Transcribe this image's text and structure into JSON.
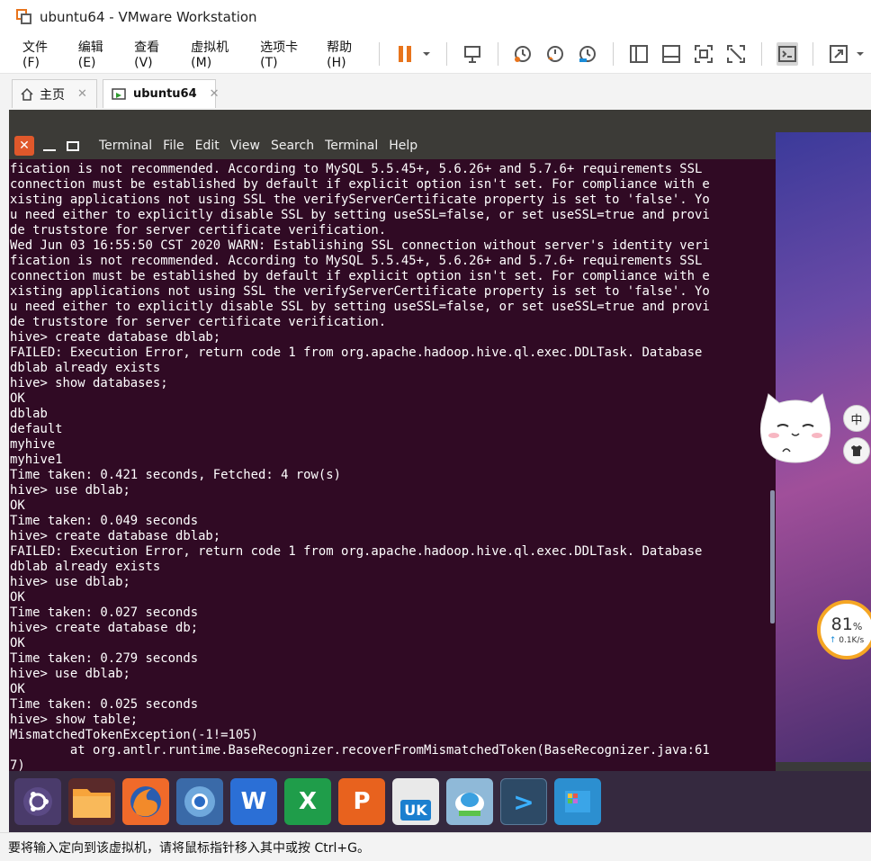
{
  "window": {
    "title": "ubuntu64 - VMware Workstation",
    "icon": "vmware-icon"
  },
  "menu": {
    "items": [
      "文件(F)",
      "编辑(E)",
      "查看(V)",
      "虚拟机(M)",
      "选项卡(T)",
      "帮助(H)"
    ]
  },
  "tabs": [
    {
      "label": "主页",
      "icon": "home-icon"
    },
    {
      "label": "ubuntu64",
      "icon": "vm-icon"
    }
  ],
  "terminal": {
    "menu": [
      "Terminal",
      "File",
      "Edit",
      "View",
      "Search",
      "Terminal",
      "Help"
    ],
    "lines": [
      "fication is not recommended. According to MySQL 5.5.45+, 5.6.26+ and 5.7.6+ requirements SSL",
      "connection must be established by default if explicit option isn't set. For compliance with e",
      "xisting applications not using SSL the verifyServerCertificate property is set to 'false'. Yo",
      "u need either to explicitly disable SSL by setting useSSL=false, or set useSSL=true and provi",
      "de truststore for server certificate verification.",
      "Wed Jun 03 16:55:50 CST 2020 WARN: Establishing SSL connection without server's identity veri",
      "fication is not recommended. According to MySQL 5.5.45+, 5.6.26+ and 5.7.6+ requirements SSL",
      "connection must be established by default if explicit option isn't set. For compliance with e",
      "xisting applications not using SSL the verifyServerCertificate property is set to 'false'. Yo",
      "u need either to explicitly disable SSL by setting useSSL=false, or set useSSL=true and provi",
      "de truststore for server certificate verification.",
      "hive> create database dblab;",
      "FAILED: Execution Error, return code 1 from org.apache.hadoop.hive.ql.exec.DDLTask. Database",
      "dblab already exists",
      "hive> show databases;",
      "OK",
      "dblab",
      "default",
      "myhive",
      "myhive1",
      "Time taken: 0.421 seconds, Fetched: 4 row(s)",
      "hive> use dblab;",
      "OK",
      "Time taken: 0.049 seconds",
      "hive> create database dblab;",
      "FAILED: Execution Error, return code 1 from org.apache.hadoop.hive.ql.exec.DDLTask. Database",
      "dblab already exists",
      "hive> use dblab;",
      "OK",
      "Time taken: 0.027 seconds",
      "hive> create database db;",
      "OK",
      "Time taken: 0.279 seconds",
      "hive> use dblab;",
      "OK",
      "Time taken: 0.025 seconds",
      "hive> show table;",
      "MismatchedTokenException(-1!=105)",
      "        at org.antlr.runtime.BaseRecognizer.recoverFromMismatchedToken(BaseRecognizer.java:61",
      "7)"
    ]
  },
  "dock": {
    "apps": [
      {
        "name": "ubuntu-icon"
      },
      {
        "name": "files-icon"
      },
      {
        "name": "firefox-icon"
      },
      {
        "name": "chromium-icon"
      },
      {
        "name": "writer-icon",
        "glyph": "W"
      },
      {
        "name": "calc-icon",
        "glyph": "X"
      },
      {
        "name": "impress-icon",
        "glyph": "P"
      },
      {
        "name": "software-center-icon",
        "glyph": "UK"
      },
      {
        "name": "vm-app-icon"
      },
      {
        "name": "terminal-app-icon",
        "glyph": ">"
      },
      {
        "name": "workspace-switcher-icon"
      }
    ]
  },
  "overlay": {
    "ime_label": "中",
    "speed_percent": "81",
    "speed_percent_unit": "%",
    "speed_rate": "0.1K/s",
    "speed_arrow": "↑"
  },
  "status": {
    "text": "要将输入定向到该虚拟机，请将鼠标指针移入其中或按 Ctrl+G。"
  },
  "colors": {
    "terminal_bg": "#300a24",
    "accent_orange": "#e8741c"
  }
}
